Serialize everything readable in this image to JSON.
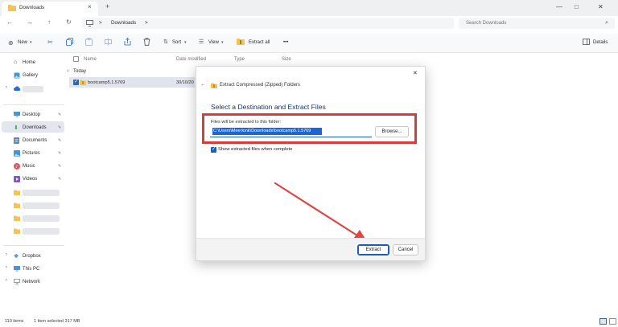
{
  "window": {
    "tab_title": "Downloads",
    "tab_close": "×",
    "tab_add": "+",
    "min": "—",
    "max": "□",
    "close": "✕"
  },
  "address": {
    "back": "←",
    "forward": "→",
    "up": "↑",
    "refresh": "↻",
    "sep1": ">",
    "folder": "Downloads",
    "sep2": ">",
    "search_placeholder": "Search Downloads"
  },
  "toolbar": {
    "new_label": "New",
    "sort_label": "Sort",
    "view_label": "View",
    "extract_all_label": "Extract all",
    "more_label": "•••",
    "details_label": "Details"
  },
  "sidebar": {
    "home": "Home",
    "gallery": "Gallery",
    "desktop": "Desktop",
    "downloads": "Downloads",
    "documents": "Documents",
    "pictures": "Pictures",
    "music": "Music",
    "videos": "Videos",
    "dropbox": "Dropbox",
    "this_pc": "This PC",
    "network": "Network"
  },
  "list": {
    "columns": [
      "Name",
      "Date modified",
      "Type",
      "Size"
    ],
    "group": "Today",
    "file_name": "bootcamp5.1.5769",
    "file_date": "30/10/20"
  },
  "status": {
    "count": "110 items",
    "selection": "1 item selected  317 MB"
  },
  "dialog": {
    "title": "Extract Compressed (Zipped) Folders",
    "heading": "Select a Destination and Extract Files",
    "caption": "Files will be extracted to this folder:",
    "path": "C:\\Users\\Meerlonk\\Downloads\\bootcamp5.1.5769",
    "browse_label": "Browse...",
    "checkbox_label": "Show extracted files when complete",
    "checked": true,
    "extract_label": "Extract",
    "cancel_label": "Cancel",
    "close": "✕",
    "back": "←"
  },
  "colors": {
    "accent": "#1a5fb4",
    "highlight_box": "#d63c3c",
    "arrow": "#e04646",
    "folder": "#f2c14e"
  }
}
